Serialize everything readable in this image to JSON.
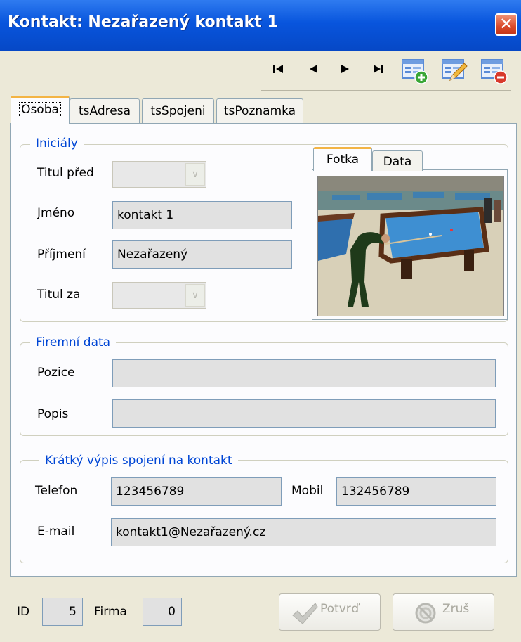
{
  "window": {
    "title": "Kontakt: Nezařazený kontakt 1",
    "close_glyph": "✕"
  },
  "navigator": {
    "icons": [
      "first-record-icon",
      "prior-record-icon",
      "next-record-icon",
      "last-record-icon",
      "add-record-icon",
      "edit-record-icon",
      "delete-record-icon"
    ]
  },
  "tabs": [
    {
      "label": "Osoba",
      "active": true
    },
    {
      "label": "tsAdresa",
      "active": false
    },
    {
      "label": "tsSpojeni",
      "active": false
    },
    {
      "label": "tsPoznamka",
      "active": false
    }
  ],
  "initials": {
    "legend": "Iniciály",
    "title_before_label": "Titul před",
    "title_before_value": "",
    "first_name_label": "Jméno",
    "first_name_value": "kontakt 1",
    "last_name_label": "Příjmení",
    "last_name_value": "Nezařazený",
    "title_after_label": "Titul za",
    "title_after_value": ""
  },
  "photo": {
    "tabs": [
      {
        "label": "Fotka",
        "active": true
      },
      {
        "label": "Data",
        "active": false
      }
    ]
  },
  "company": {
    "legend": "Firemní data",
    "position_label": "Pozice",
    "position_value": "",
    "description_label": "Popis",
    "description_value": ""
  },
  "contact": {
    "legend": "Krátký výpis spojení na kontakt",
    "phone_label": "Telefon",
    "phone_value": "123456789",
    "mobile_label": "Mobil",
    "mobile_value": "132456789",
    "email_label": "E-mail",
    "email_value": "kontakt1@Nezařazený.cz"
  },
  "footer": {
    "id_label": "ID",
    "id_value": "5",
    "company_label": "Firma",
    "company_value": "0",
    "confirm_label": "Potvrď",
    "cancel_label": "Zruš"
  },
  "colors": {
    "title_bar": "#0855dd",
    "legend_text": "#0046d5",
    "tab_highlight": "#f3b444",
    "window_bg": "#ece9d8",
    "close_button": "#d94a2b"
  }
}
